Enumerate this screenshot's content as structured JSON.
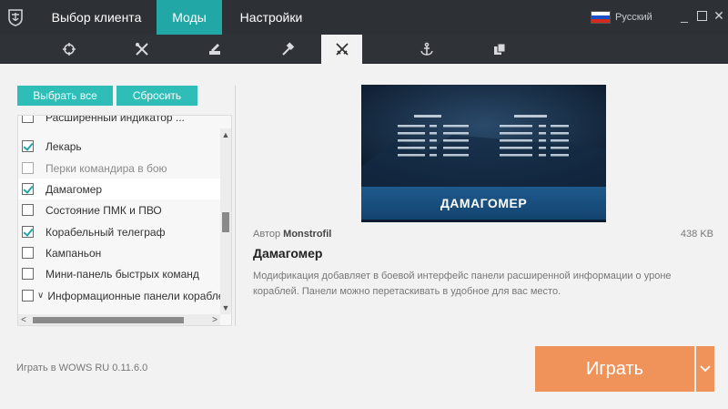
{
  "titlebar": {
    "tabs": [
      {
        "label": "Выбор клиента",
        "active": false
      },
      {
        "label": "Моды",
        "active": true
      },
      {
        "label": "Настройки",
        "active": false
      }
    ],
    "language": "Русский",
    "window_controls": [
      "minimize-icon",
      "maximize-icon",
      "close-icon"
    ]
  },
  "categories": [
    "crosshair-icon",
    "tools-icon",
    "edit-icon",
    "hammer-icon",
    "crossed-swords-icon",
    "anchor-icon",
    "copy-icon"
  ],
  "active_category": 4,
  "buttons": {
    "select_all": "Выбрать все",
    "reset": "Сбросить"
  },
  "mods": [
    {
      "label": "Расширенный индикатор ...",
      "checked": false,
      "disabled": false
    },
    {
      "label": "Лекарь",
      "checked": true,
      "disabled": false
    },
    {
      "label": "Перки командира в бою",
      "checked": false,
      "disabled": true
    },
    {
      "label": "Дамагомер",
      "checked": true,
      "disabled": false,
      "selected": true
    },
    {
      "label": "Состояние ПМК и ПВО",
      "checked": false,
      "disabled": false
    },
    {
      "label": "Корабельный телеграф",
      "checked": true,
      "disabled": false
    },
    {
      "label": "Кампаньон",
      "checked": false,
      "disabled": false
    },
    {
      "label": "Мини-панель быстрых команд",
      "checked": false,
      "disabled": false
    },
    {
      "label": "Информационные панели корабле",
      "checked": false,
      "disabled": false,
      "expandable": true
    }
  ],
  "details": {
    "preview_banner": "ДАМАГОМЕР",
    "author_label": "Автор",
    "author_name": "Monstrofil",
    "size": "438 KB",
    "title": "Дамагомер",
    "description": "Модификация добавляет в боевой интерфейс панели расширенной информации о уроне кораблей. Панели можно перетаскивать в удобное для вас место."
  },
  "footer": {
    "version": "Играть в WOWS RU 0.11.6.0",
    "play": "Играть"
  },
  "colors": {
    "accent": "#21a7a6",
    "play": "#f0935a",
    "titlebar": "#2d3136"
  }
}
